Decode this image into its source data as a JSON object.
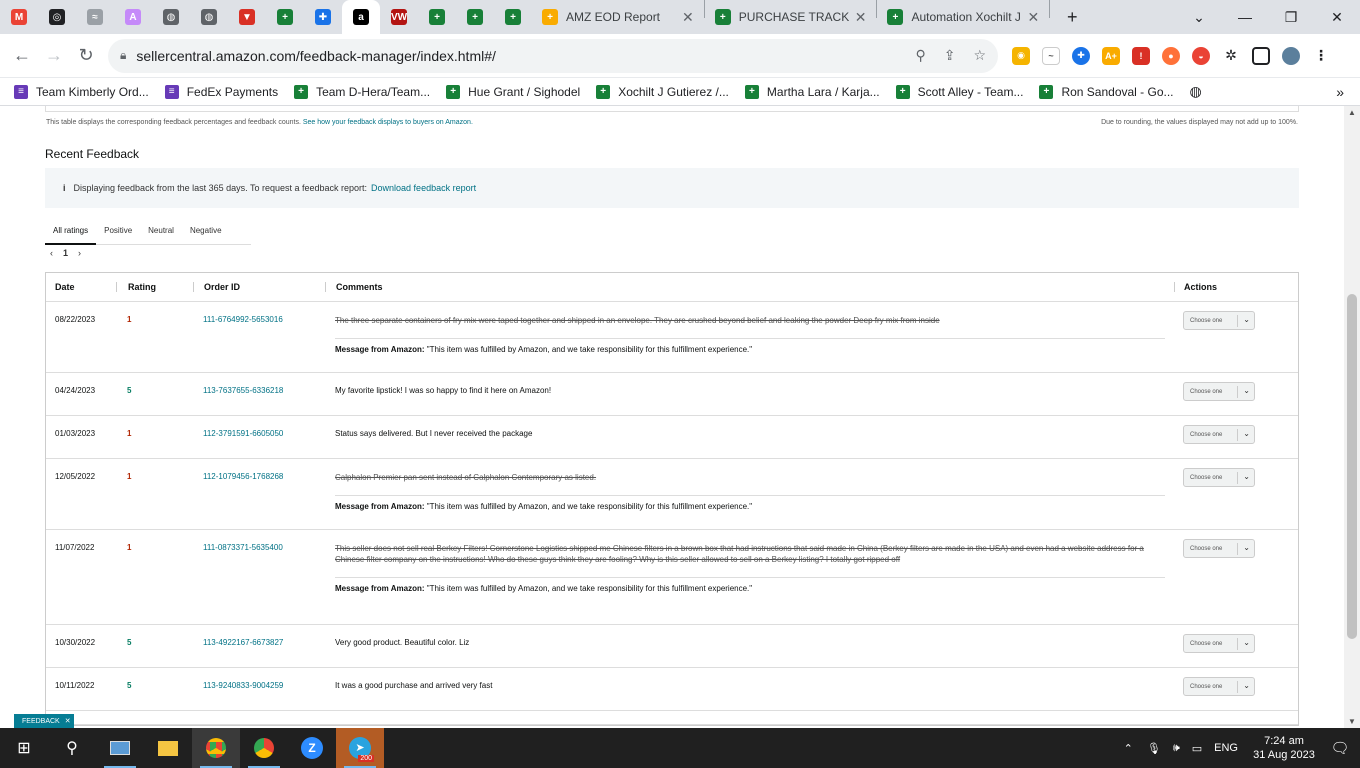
{
  "browser": {
    "pinned_tabs": [
      {
        "name": "gmail",
        "letter": "M",
        "color": "#ea4335"
      },
      {
        "name": "openai",
        "letter": "◎",
        "color": "#202124"
      },
      {
        "name": "pinned-3",
        "letter": "≈",
        "color": "#9aa0a6"
      },
      {
        "name": "pinned-4",
        "letter": "A",
        "color": "#c58af9"
      },
      {
        "name": "globe-1",
        "letter": "◍",
        "color": "#5f6368"
      },
      {
        "name": "globe-2",
        "letter": "◍",
        "color": "#5f6368"
      },
      {
        "name": "pinned-7",
        "letter": "▼",
        "color": "#d93025"
      },
      {
        "name": "sheets-1",
        "letter": "+",
        "color": "#188038"
      },
      {
        "name": "pinned-9",
        "letter": "✚",
        "color": "#1a73e8"
      },
      {
        "name": "amazon",
        "letter": "a",
        "color": "#000000"
      },
      {
        "name": "pinned-11",
        "letter": "VW",
        "color": "#b31412"
      },
      {
        "name": "sheets-2",
        "letter": "+",
        "color": "#188038"
      },
      {
        "name": "sheets-3",
        "letter": "+",
        "color": "#188038"
      },
      {
        "name": "sheets-4",
        "letter": "+",
        "color": "#188038"
      }
    ],
    "tabs": [
      {
        "title": "AMZ EOD Report",
        "color": "#f9ab00"
      },
      {
        "title": "PURCHASE TRACKER",
        "color": "#188038"
      },
      {
        "title": "Automation Xochilt J",
        "color": "#188038"
      }
    ],
    "url": "sellercentral.amazon.com/feedback-manager/index.html#/",
    "bookmarks": [
      {
        "label": "Team Kimberly Ord...",
        "color": "#673ab7"
      },
      {
        "label": "FedEx Payments",
        "color": "#673ab7"
      },
      {
        "label": "Team D-Hera/Team...",
        "color": "#188038"
      },
      {
        "label": "Hue Grant / Sighodel",
        "color": "#188038"
      },
      {
        "label": "Xochilt J Gutierez /...",
        "color": "#188038"
      },
      {
        "label": "Martha Lara / Karja...",
        "color": "#188038"
      },
      {
        "label": "Scott Alley - Team...",
        "color": "#188038"
      },
      {
        "label": "Ron Sandoval - Go...",
        "color": "#188038"
      }
    ]
  },
  "page": {
    "table_note": "This table displays the corresponding feedback percentages and feedback counts.",
    "table_note_link": "See how your feedback displays to buyers on Amazon.",
    "rounding_note": "Due to rounding, the values displayed may not add up to 100%.",
    "section_title": "Recent Feedback",
    "info_text": "Displaying feedback from the last 365 days. To request a feedback report:",
    "info_link": "Download feedback report",
    "tabs": [
      "All ratings",
      "Positive",
      "Neutral",
      "Negative"
    ],
    "page_number": "1",
    "columns": {
      "date": "Date",
      "rating": "Rating",
      "order": "Order ID",
      "comments": "Comments",
      "actions": "Actions"
    },
    "message_label": "Message from Amazon:",
    "message_text": "\"This item was fulfilled by Amazon, and we take responsibility for this fulfillment experience.\"",
    "choose": "Choose one",
    "rows": [
      {
        "date": "08/22/2023",
        "rating": "1",
        "order": "111-6764992-5653016",
        "comment": "The three separate containers of fry mix were taped together and shipped in an envelope. They are crushed beyond belief and leaking the powder Deep fry mix from inside",
        "struck": true
      },
      {
        "date": "04/24/2023",
        "rating": "5",
        "order": "113-7637655-6336218",
        "comment": "My favorite lipstick! I was so happy to find it here on Amazon!",
        "struck": false
      },
      {
        "date": "01/03/2023",
        "rating": "1",
        "order": "112-3791591-6605050",
        "comment": "Status says delivered. But I never received the package",
        "struck": false
      },
      {
        "date": "12/05/2022",
        "rating": "1",
        "order": "112-1079456-1768268",
        "comment": "Calphalon Premier pan sent instead of Calphalon Contemporary as listed.",
        "struck": true
      },
      {
        "date": "11/07/2022",
        "rating": "1",
        "order": "111-0873371-5635400",
        "comment": "This seller does not sell real Berkey Filters! Cornerstone Logistics shipped me Chinese filters in a brown box that had instructions that said made in China (Berkey filters are made in the USA) and even had a website address for a Chinese filter company on the instructions! Who do these guys think they are fooling? Why is this seller allowed to sell on a Berkey listing? I totally got ripped off",
        "struck": true
      },
      {
        "date": "10/30/2022",
        "rating": "5",
        "order": "113-4922167-6673827",
        "comment": "Very good product. Beautiful color. Liz",
        "struck": false
      },
      {
        "date": "10/11/2022",
        "rating": "5",
        "order": "113-9240833-9004259",
        "comment": "It was a good purchase and arrived very fast",
        "struck": false
      }
    ],
    "feedback_button": "FEEDBACK"
  },
  "taskbar": {
    "language": "ENG",
    "time": "7:24 am",
    "date": "31 Aug 2023",
    "telegram_badge": "200"
  }
}
